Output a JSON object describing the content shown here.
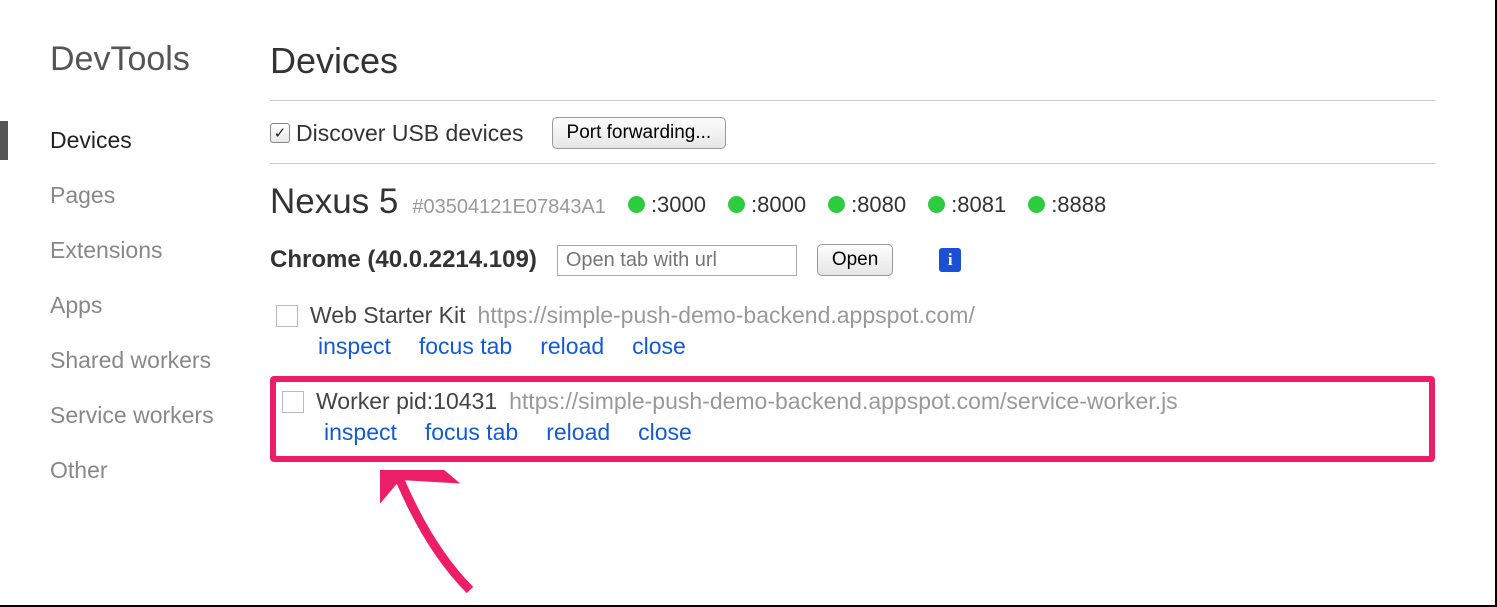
{
  "sidebar": {
    "title": "DevTools",
    "items": [
      {
        "label": "Devices",
        "active": true
      },
      {
        "label": "Pages"
      },
      {
        "label": "Extensions"
      },
      {
        "label": "Apps"
      },
      {
        "label": "Shared workers"
      },
      {
        "label": "Service workers"
      },
      {
        "label": "Other"
      }
    ]
  },
  "main": {
    "title": "Devices",
    "discover_label": "Discover USB devices",
    "discover_checked": true,
    "port_forwarding_btn": "Port forwarding...",
    "device": {
      "name": "Nexus 5",
      "id": "#03504121E07843A1",
      "ports": [
        ":3000",
        ":8000",
        ":8080",
        ":8081",
        ":8888"
      ]
    },
    "browser": {
      "label": "Chrome (40.0.2214.109)",
      "input_placeholder": "Open tab with url",
      "open_btn": "Open"
    },
    "targets": [
      {
        "title": "Web Starter Kit",
        "url": "https://simple-push-demo-backend.appspot.com/",
        "actions": [
          "inspect",
          "focus tab",
          "reload",
          "close"
        ],
        "highlighted": false
      },
      {
        "title": "Worker pid:10431",
        "url": "https://simple-push-demo-backend.appspot.com/service-worker.js",
        "actions": [
          "inspect",
          "focus tab",
          "reload",
          "close"
        ],
        "highlighted": true
      }
    ]
  }
}
